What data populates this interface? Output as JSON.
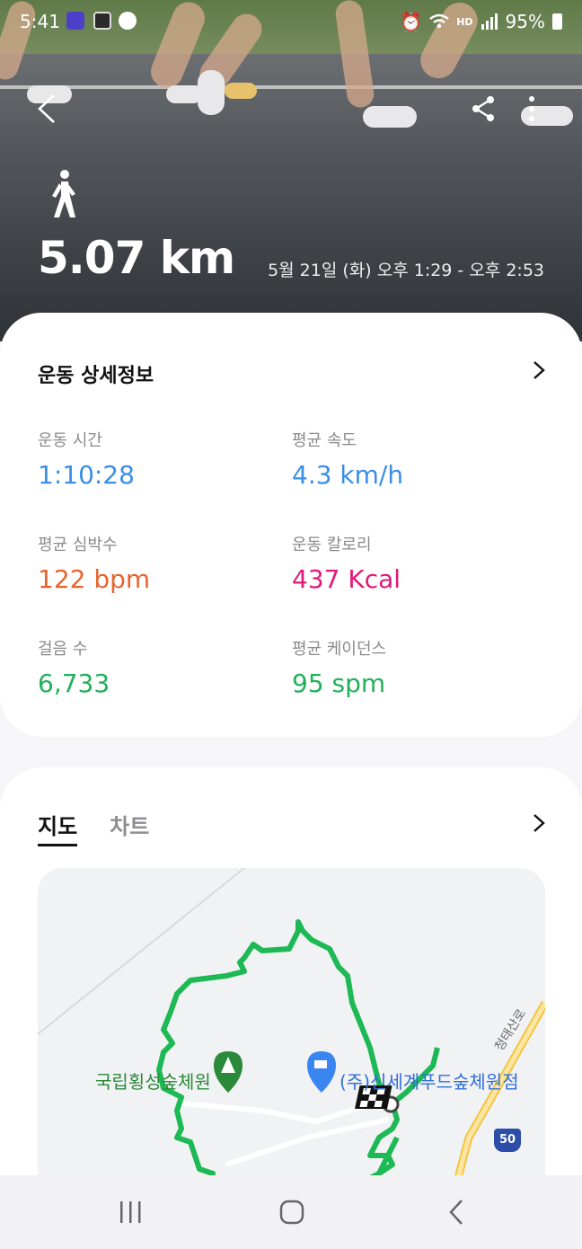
{
  "status_bar": {
    "time": "5:41",
    "battery": "95%"
  },
  "header": {
    "distance": "5.07 km",
    "datetime": "5월 21일 (화) 오후 1:29 - 오후 2:53"
  },
  "details": {
    "title": "운동 상세정보",
    "stats": [
      {
        "label": "운동 시간",
        "value": "1:10:28",
        "color": "#3a8ee6"
      },
      {
        "label": "평균 속도",
        "value": "4.3 km/h",
        "color": "#3a8ee6"
      },
      {
        "label": "평균 심박수",
        "value": "122 bpm",
        "color": "#e8642c"
      },
      {
        "label": "운동 칼로리",
        "value": "437 Kcal",
        "color": "#e3197a"
      },
      {
        "label": "걸음 수",
        "value": "6,733",
        "color": "#22b05a"
      },
      {
        "label": "평균 케이던스",
        "value": "95 spm",
        "color": "#22b05a"
      }
    ]
  },
  "map_section": {
    "tabs": [
      {
        "label": "지도",
        "active": true
      },
      {
        "label": "차트",
        "active": false
      }
    ],
    "map_labels": {
      "park": "국립횡성숲체원",
      "store": "(주)신세계푸드숲체원점",
      "road": "청태산로",
      "route_shield": "50"
    },
    "route_color": "#1db954"
  }
}
